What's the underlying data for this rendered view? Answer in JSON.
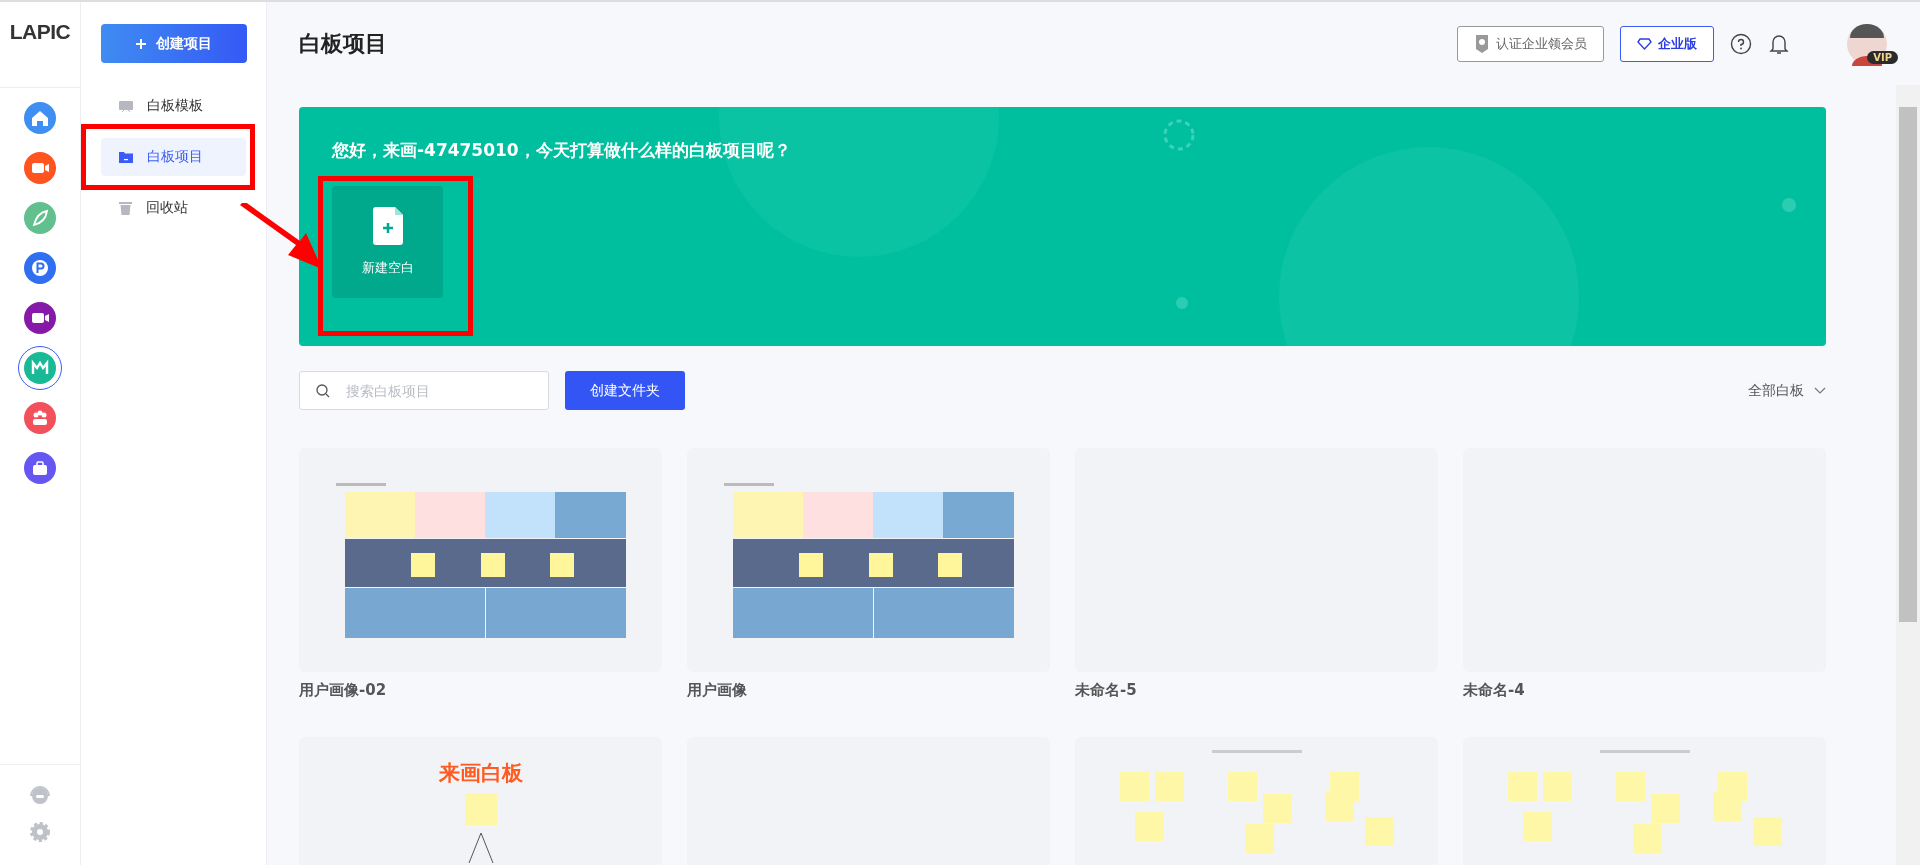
{
  "logo": {
    "text": "LAPIC"
  },
  "app_rail": {
    "items": [
      {
        "kind": "home",
        "color": "#3f8ef2",
        "selected": false
      },
      {
        "kind": "camera",
        "color": "#ff5420",
        "selected": false
      },
      {
        "kind": "leaf",
        "color": "#62bf8e",
        "selected": false
      },
      {
        "kind": "p",
        "color": "#2f6ff0",
        "selected": false
      },
      {
        "kind": "video",
        "color": "#8619a8",
        "selected": false
      },
      {
        "kind": "board",
        "color": "#19b996",
        "selected": true
      },
      {
        "kind": "team",
        "color": "#f2505a",
        "selected": false
      },
      {
        "kind": "case",
        "color": "#6656f2",
        "selected": false
      }
    ]
  },
  "sidebar": {
    "create_button": "创建项目",
    "items": [
      {
        "kind": "template",
        "label": "白板模板",
        "selected": false,
        "highlighted": false
      },
      {
        "kind": "folder",
        "label": "白板项目",
        "selected": true,
        "highlighted": true
      },
      {
        "kind": "trash",
        "label": "回收站",
        "selected": false,
        "highlighted": false
      }
    ]
  },
  "header": {
    "title": "白板项目",
    "certify_button": "认证企业领会员",
    "enterprise_button": "企业版",
    "avatar_badge": "VIP"
  },
  "banner": {
    "greeting": "您好，来画-47475010，今天打算做什么样的白板项目呢？",
    "new_blank": "新建空白",
    "new_blank_highlighted": true
  },
  "toolbar": {
    "search_placeholder": "搜索白板项目",
    "create_folder_button": "创建文件夹",
    "filter": "全部白板"
  },
  "projects": [
    {
      "kind": "persona",
      "title": "用户画像-02"
    },
    {
      "kind": "persona",
      "title": "用户画像"
    },
    {
      "kind": "blank",
      "title": "未命名-5"
    },
    {
      "kind": "blank",
      "title": "未命名-4"
    },
    {
      "kind": "logo",
      "caption": "来画白板"
    },
    {
      "kind": "blank"
    },
    {
      "kind": "sticky"
    },
    {
      "kind": "sticky"
    }
  ]
}
